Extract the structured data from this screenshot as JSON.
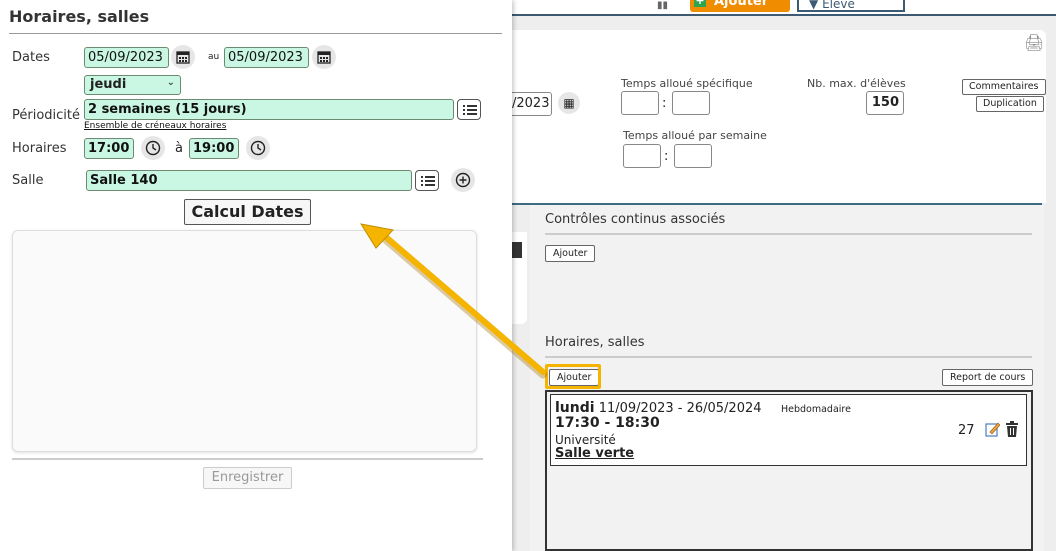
{
  "background": {
    "toolbar": {
      "ajouter_label": "Ajouter",
      "eleve_label": "Élève"
    },
    "form": {
      "date_partial": "/2023",
      "temps_specifique_label": "Temps alloué spécifique",
      "temps_semaine_label": "Temps alloué par semaine",
      "nb_max_label": "Nb. max. d'élèves",
      "nb_max_value": "150",
      "commentaires_label": "Commentaires",
      "duplication_label": "Duplication"
    },
    "controles": {
      "title": "Contrôles continus associés",
      "ajouter_label": "Ajouter"
    },
    "horaires": {
      "title": "Horaires, salles",
      "ajouter_label": "Ajouter",
      "report_label": "Report de cours",
      "course": {
        "day": "lundi",
        "dates": "11/09/2023 - 26/05/2024",
        "frequency": "Hebdomadaire",
        "time": "17:30 - 18:30",
        "place": "Université",
        "room": "Salle verte",
        "count": "27"
      }
    }
  },
  "modal": {
    "title": "Horaires, salles",
    "dates_label": "Dates",
    "date_start": "05/09/2023",
    "au_label": "au",
    "date_end": "05/09/2023",
    "day_select": "jeudi",
    "periodicite_label": "Périodicité",
    "periodicite_value": "2 semaines (15 jours)",
    "ensemble_link": "Ensemble de créneaux horaires",
    "horaires_label": "Horaires",
    "time_start": "17:00",
    "a_label": "à",
    "time_end": "19:00",
    "salle_label": "Salle",
    "salle_value": "Salle 140",
    "calc_button": "Calcul Dates",
    "save_button": "Enregistrer"
  },
  "colors": {
    "field_bg": "#c9f7e4",
    "accent_orange": "#f08c00",
    "highlight_yellow": "#f5b400",
    "nav_blue": "#3d5a73"
  }
}
